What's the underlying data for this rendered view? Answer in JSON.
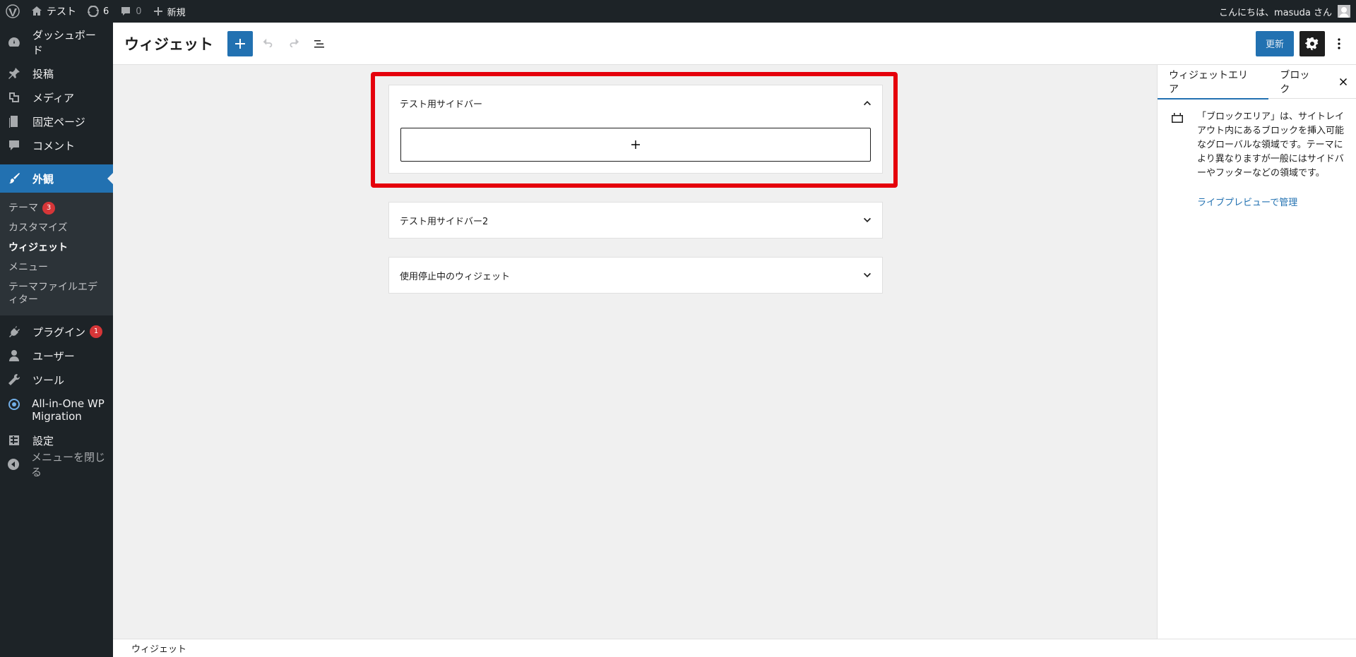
{
  "adminbar": {
    "site_name": "テスト",
    "updates_count": "6",
    "comments_count": "0",
    "new_label": "新規",
    "greeting": "こんにちは、masuda さん"
  },
  "menu": {
    "dashboard": "ダッシュボード",
    "posts": "投稿",
    "media": "メディア",
    "pages": "固定ページ",
    "comments": "コメント",
    "appearance": "外観",
    "appearance_sub": {
      "themes": "テーマ",
      "themes_badge": "3",
      "customize": "カスタマイズ",
      "widgets": "ウィジェット",
      "menus": "メニュー",
      "theme_editor": "テーマファイルエディター"
    },
    "plugins": "プラグイン",
    "plugins_badge": "1",
    "users": "ユーザー",
    "tools": "ツール",
    "aiowp": "All-in-One WP Migration",
    "settings": "設定",
    "collapse": "メニューを閉じる"
  },
  "editor": {
    "title": "ウィジェット",
    "update_label": "更新"
  },
  "widget_areas": [
    {
      "title": "テスト用サイドバー",
      "expanded": true
    },
    {
      "title": "テスト用サイドバー2",
      "expanded": false
    },
    {
      "title": "使用停止中のウィジェット",
      "expanded": false
    }
  ],
  "panel": {
    "tab_area": "ウィジェットエリア",
    "tab_block": "ブロック",
    "description": "「ブロックエリア」は、サイトレイアウト内にあるブロックを挿入可能なグローバルな領域です。テーマにより異なりますが一般にはサイドバーやフッターなどの領域です。",
    "link": "ライブプレビューで管理"
  },
  "footer": {
    "breadcrumb": "ウィジェット"
  },
  "colors": {
    "accent": "#2271b1",
    "highlight": "#e5000c",
    "admin_dark": "#1d2327"
  }
}
